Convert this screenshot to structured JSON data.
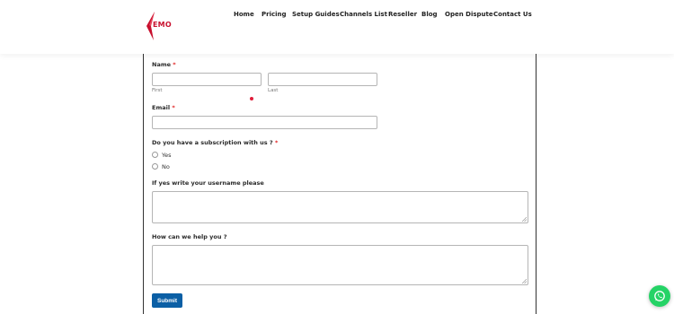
{
  "logo": {
    "text": "EMO",
    "icon": "logo-icon"
  },
  "nav": [
    {
      "label": "Home"
    },
    {
      "label": "Pricing"
    },
    {
      "label": "Setup Guides"
    },
    {
      "label": "Channels List"
    },
    {
      "label": "Reseller"
    },
    {
      "label": "Blog"
    },
    {
      "label": "Open Dispute"
    },
    {
      "label": "Contact Us"
    }
  ],
  "form": {
    "name_label": "Name",
    "required_mark": "*",
    "first_sub": "First",
    "last_sub": "Last",
    "email_label": "Email",
    "subscription_label": "Do you have a subscription with us ?",
    "options": [
      {
        "label": "Yes"
      },
      {
        "label": "No"
      }
    ],
    "username_label": "If yes write your username please",
    "help_label": "How can we help you ?",
    "submit_label": "Submit"
  },
  "widgets": {
    "whatsapp_icon": "whatsapp-icon"
  },
  "colors": {
    "accent": "#c8102e",
    "button": "#0b5fa5",
    "whatsapp": "#25d366"
  }
}
